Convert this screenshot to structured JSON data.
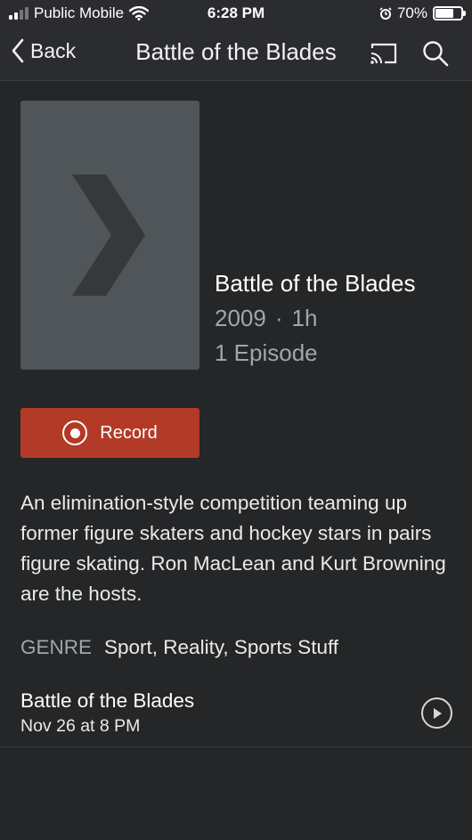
{
  "status_bar": {
    "carrier": "Public Mobile",
    "time": "6:28 PM",
    "battery_percent": "70%",
    "battery_level": 0.7,
    "icons": [
      "signal-icon",
      "wifi-icon",
      "alarm-icon",
      "battery-icon"
    ]
  },
  "nav": {
    "back_label": "Back",
    "title": "Battle of the Blades",
    "icons": [
      "cast-icon",
      "search-icon"
    ]
  },
  "show": {
    "title": "Battle of the Blades",
    "year": "2009",
    "separator": "·",
    "duration": "1h",
    "episodes": "1 Episode",
    "poster_icon": "chevron-right-icon"
  },
  "record": {
    "label": "Record",
    "icon": "record-icon"
  },
  "description": "An elimination-style competition teaming up former figure skaters and hockey stars in pairs figure skating. Ron MacLean and Kurt Browning are the hosts.",
  "genre": {
    "label": "GENRE",
    "value": "Sport, Reality, Sports Stuff"
  },
  "airing": {
    "title": "Battle of the Blades",
    "time": "Nov 26 at 8 PM",
    "icon": "play-icon"
  },
  "colors": {
    "background": "#242628",
    "record_button": "#b33a27",
    "secondary_text": "#a2a6aa",
    "poster": "#4f5558"
  }
}
